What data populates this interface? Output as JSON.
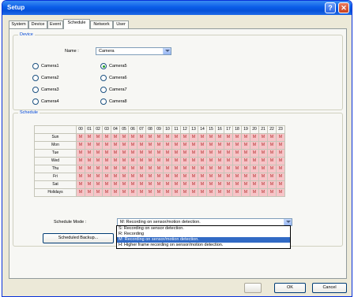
{
  "window": {
    "title": "Setup"
  },
  "tabs": [
    "System",
    "Device",
    "Event",
    "Schedule",
    "Network",
    "User"
  ],
  "active_tab": "Schedule",
  "device": {
    "group_title": "Device",
    "name_label": "Name :",
    "name_value": "Camera",
    "cameras": [
      "Camera1",
      "Camera2",
      "Camera3",
      "Camera4",
      "Camera5",
      "Camera6",
      "Camera7",
      "Camera8"
    ],
    "selected_camera": "Camera5"
  },
  "schedule": {
    "group_title": "Schedule",
    "hours": [
      "00",
      "01",
      "02",
      "03",
      "04",
      "05",
      "06",
      "07",
      "08",
      "09",
      "10",
      "11",
      "12",
      "13",
      "14",
      "15",
      "16",
      "17",
      "18",
      "19",
      "20",
      "21",
      "22",
      "23"
    ],
    "days": [
      "Sun",
      "Mon",
      "Tue",
      "Wed",
      "Thu",
      "Fri",
      "Sat",
      "Holidays"
    ],
    "cell_value": "M",
    "mode_label": "Schedule Mode :",
    "mode_value": "M: Recording on sensor/motion detection.",
    "mode_options": [
      "S: Recording on sensor detection.",
      "R: Recording",
      "M: Recording on sensor/motion detection.",
      "H: Higher frame recording on sensor/motion detection."
    ],
    "selected_option_index": 2,
    "backup_button": "Scheduled Backup..."
  },
  "footer": {
    "ok": "OK",
    "cancel": "Cancel"
  },
  "colors": {
    "cell_bg": "#f6c5c8",
    "cell_text": "#b22222",
    "group_title": "#0046d5",
    "selection": "#316ac5"
  }
}
